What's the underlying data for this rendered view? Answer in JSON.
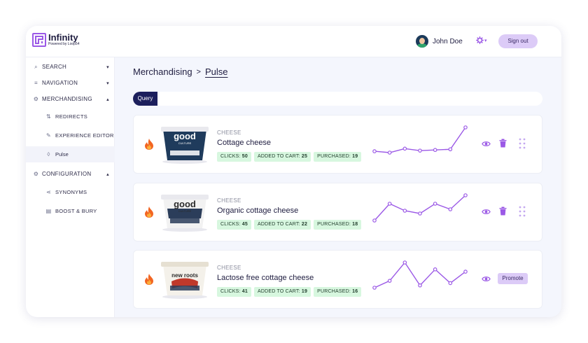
{
  "brand": {
    "name": "Infinity",
    "tagline": "Powered by Loop54",
    "accent": "#9b59e6"
  },
  "header": {
    "user_name": "John Doe",
    "signout_label": "Sign out"
  },
  "sidebar": {
    "items": [
      {
        "label": "SEARCH",
        "icon": "search-icon",
        "chev": "▾"
      },
      {
        "label": "NAVIGATION",
        "icon": "list-icon",
        "chev": "▾"
      },
      {
        "label": "MERCHANDISING",
        "icon": "gear-icon",
        "chev": "▴"
      },
      {
        "label": "REDIRECTS",
        "icon": "redirect-icon",
        "sub": true
      },
      {
        "label": "EXPERIENCE EDITOR",
        "icon": "pencil-icon",
        "sub": true
      },
      {
        "label": "Pulse",
        "icon": "flame-icon",
        "sub": true,
        "active": true
      },
      {
        "label": "CONFIGURATION",
        "icon": "gear-icon",
        "chev": "▴"
      },
      {
        "label": "SYNONYMS",
        "icon": "share-icon",
        "sub": true
      },
      {
        "label": "BOOST & BURY",
        "icon": "boost-icon",
        "sub": true
      }
    ]
  },
  "breadcrumb": {
    "parent": "Merchandising",
    "separator": ">",
    "current": "Pulse"
  },
  "query": {
    "label": "Query"
  },
  "tag_labels": {
    "clicks": "CLICKS:",
    "cart": "ADDED TO CART:",
    "purchased": "PURCHASED:"
  },
  "products": [
    {
      "category": "CHEESE",
      "name": "Cottage cheese",
      "clicks": "50",
      "cart": "25",
      "purchased": "19",
      "trend": [
        4,
        2,
        8,
        5,
        6,
        7,
        40
      ],
      "brand_text": "good",
      "brand_sub": "CULTURE",
      "actions": "delete"
    },
    {
      "category": "CHEESE",
      "name": "Organic cottage cheese",
      "clicks": "45",
      "cart": "22",
      "purchased": "18",
      "trend": [
        2,
        14,
        9,
        7,
        14,
        10,
        20
      ],
      "brand_text": "good",
      "brand_sub": "CULTURE",
      "actions": "delete"
    },
    {
      "category": "CHEESE",
      "name": "Lactose free cottage cheese",
      "clicks": "41",
      "cart": "19",
      "purchased": "16",
      "trend": [
        3,
        6,
        14,
        4,
        11,
        5,
        10
      ],
      "brand_text": "new roots",
      "brand_sub": "",
      "actions": "promote",
      "promote_label": "Promote"
    }
  ]
}
